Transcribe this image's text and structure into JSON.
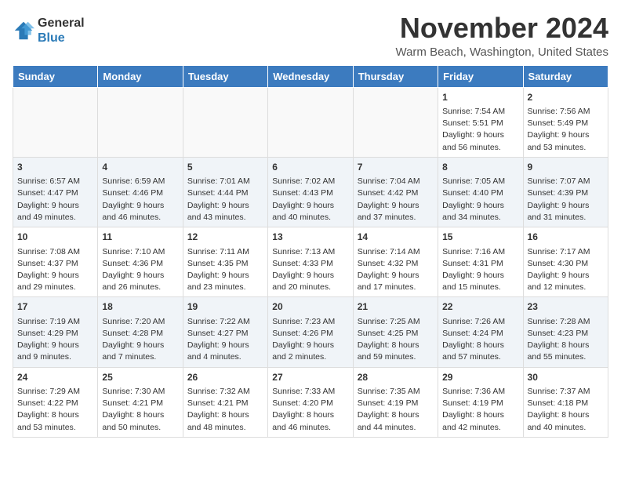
{
  "header": {
    "logo_line1": "General",
    "logo_line2": "Blue",
    "month": "November 2024",
    "location": "Warm Beach, Washington, United States"
  },
  "weekdays": [
    "Sunday",
    "Monday",
    "Tuesday",
    "Wednesday",
    "Thursday",
    "Friday",
    "Saturday"
  ],
  "weeks": [
    [
      {
        "day": "",
        "info": ""
      },
      {
        "day": "",
        "info": ""
      },
      {
        "day": "",
        "info": ""
      },
      {
        "day": "",
        "info": ""
      },
      {
        "day": "",
        "info": ""
      },
      {
        "day": "1",
        "info": "Sunrise: 7:54 AM\nSunset: 5:51 PM\nDaylight: 9 hours\nand 56 minutes."
      },
      {
        "day": "2",
        "info": "Sunrise: 7:56 AM\nSunset: 5:49 PM\nDaylight: 9 hours\nand 53 minutes."
      }
    ],
    [
      {
        "day": "3",
        "info": "Sunrise: 6:57 AM\nSunset: 4:47 PM\nDaylight: 9 hours\nand 49 minutes."
      },
      {
        "day": "4",
        "info": "Sunrise: 6:59 AM\nSunset: 4:46 PM\nDaylight: 9 hours\nand 46 minutes."
      },
      {
        "day": "5",
        "info": "Sunrise: 7:01 AM\nSunset: 4:44 PM\nDaylight: 9 hours\nand 43 minutes."
      },
      {
        "day": "6",
        "info": "Sunrise: 7:02 AM\nSunset: 4:43 PM\nDaylight: 9 hours\nand 40 minutes."
      },
      {
        "day": "7",
        "info": "Sunrise: 7:04 AM\nSunset: 4:42 PM\nDaylight: 9 hours\nand 37 minutes."
      },
      {
        "day": "8",
        "info": "Sunrise: 7:05 AM\nSunset: 4:40 PM\nDaylight: 9 hours\nand 34 minutes."
      },
      {
        "day": "9",
        "info": "Sunrise: 7:07 AM\nSunset: 4:39 PM\nDaylight: 9 hours\nand 31 minutes."
      }
    ],
    [
      {
        "day": "10",
        "info": "Sunrise: 7:08 AM\nSunset: 4:37 PM\nDaylight: 9 hours\nand 29 minutes."
      },
      {
        "day": "11",
        "info": "Sunrise: 7:10 AM\nSunset: 4:36 PM\nDaylight: 9 hours\nand 26 minutes."
      },
      {
        "day": "12",
        "info": "Sunrise: 7:11 AM\nSunset: 4:35 PM\nDaylight: 9 hours\nand 23 minutes."
      },
      {
        "day": "13",
        "info": "Sunrise: 7:13 AM\nSunset: 4:33 PM\nDaylight: 9 hours\nand 20 minutes."
      },
      {
        "day": "14",
        "info": "Sunrise: 7:14 AM\nSunset: 4:32 PM\nDaylight: 9 hours\nand 17 minutes."
      },
      {
        "day": "15",
        "info": "Sunrise: 7:16 AM\nSunset: 4:31 PM\nDaylight: 9 hours\nand 15 minutes."
      },
      {
        "day": "16",
        "info": "Sunrise: 7:17 AM\nSunset: 4:30 PM\nDaylight: 9 hours\nand 12 minutes."
      }
    ],
    [
      {
        "day": "17",
        "info": "Sunrise: 7:19 AM\nSunset: 4:29 PM\nDaylight: 9 hours\nand 9 minutes."
      },
      {
        "day": "18",
        "info": "Sunrise: 7:20 AM\nSunset: 4:28 PM\nDaylight: 9 hours\nand 7 minutes."
      },
      {
        "day": "19",
        "info": "Sunrise: 7:22 AM\nSunset: 4:27 PM\nDaylight: 9 hours\nand 4 minutes."
      },
      {
        "day": "20",
        "info": "Sunrise: 7:23 AM\nSunset: 4:26 PM\nDaylight: 9 hours\nand 2 minutes."
      },
      {
        "day": "21",
        "info": "Sunrise: 7:25 AM\nSunset: 4:25 PM\nDaylight: 8 hours\nand 59 minutes."
      },
      {
        "day": "22",
        "info": "Sunrise: 7:26 AM\nSunset: 4:24 PM\nDaylight: 8 hours\nand 57 minutes."
      },
      {
        "day": "23",
        "info": "Sunrise: 7:28 AM\nSunset: 4:23 PM\nDaylight: 8 hours\nand 55 minutes."
      }
    ],
    [
      {
        "day": "24",
        "info": "Sunrise: 7:29 AM\nSunset: 4:22 PM\nDaylight: 8 hours\nand 53 minutes."
      },
      {
        "day": "25",
        "info": "Sunrise: 7:30 AM\nSunset: 4:21 PM\nDaylight: 8 hours\nand 50 minutes."
      },
      {
        "day": "26",
        "info": "Sunrise: 7:32 AM\nSunset: 4:21 PM\nDaylight: 8 hours\nand 48 minutes."
      },
      {
        "day": "27",
        "info": "Sunrise: 7:33 AM\nSunset: 4:20 PM\nDaylight: 8 hours\nand 46 minutes."
      },
      {
        "day": "28",
        "info": "Sunrise: 7:35 AM\nSunset: 4:19 PM\nDaylight: 8 hours\nand 44 minutes."
      },
      {
        "day": "29",
        "info": "Sunrise: 7:36 AM\nSunset: 4:19 PM\nDaylight: 8 hours\nand 42 minutes."
      },
      {
        "day": "30",
        "info": "Sunrise: 7:37 AM\nSunset: 4:18 PM\nDaylight: 8 hours\nand 40 minutes."
      }
    ]
  ]
}
